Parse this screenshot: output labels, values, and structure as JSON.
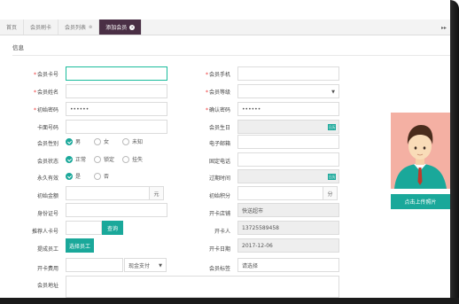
{
  "tabs": [
    {
      "label": "首页",
      "closable": false,
      "active": false
    },
    {
      "label": "会员刷卡",
      "closable": false,
      "active": false
    },
    {
      "label": "会员列表",
      "closable": true,
      "active": false
    },
    {
      "label": "添加会员",
      "closable": true,
      "active": true
    }
  ],
  "tab_scroll": "▸▸",
  "section_title": "信息",
  "form": {
    "card_no": {
      "label": "会员卡号",
      "value": ""
    },
    "phone": {
      "label": "会员手机",
      "value": ""
    },
    "name": {
      "label": "会员姓名",
      "value": ""
    },
    "level": {
      "label": "会员等级",
      "value": ""
    },
    "init_pwd": {
      "label": "初始密码",
      "value": "••••••"
    },
    "confirm_pwd": {
      "label": "确认密码",
      "value": "••••••"
    },
    "card_face": {
      "label": "卡面号码",
      "value": ""
    },
    "birthday": {
      "label": "会员生日",
      "value": ""
    },
    "gender": {
      "label": "会员性别",
      "options": [
        "男",
        "女",
        "未知"
      ],
      "selected": "男"
    },
    "email": {
      "label": "电子邮箱",
      "value": ""
    },
    "status": {
      "label": "会员状态",
      "options": [
        "正常",
        "锁定",
        "挂失"
      ],
      "selected": "正常"
    },
    "landline": {
      "label": "固定电话",
      "value": ""
    },
    "permanent": {
      "label": "永久有效",
      "options": [
        "是",
        "否"
      ],
      "selected": "是"
    },
    "expiry": {
      "label": "过期时间",
      "value": ""
    },
    "init_amount": {
      "label": "初始金额",
      "value": "",
      "unit": "元"
    },
    "init_points": {
      "label": "初始积分",
      "value": "",
      "unit": "分"
    },
    "id_no": {
      "label": "身份证号",
      "value": ""
    },
    "store": {
      "label": "开卡店铺",
      "value": "快送超市"
    },
    "referrer": {
      "label": "推荐人卡号",
      "value": "",
      "button": "查询"
    },
    "opener": {
      "label": "开卡人",
      "value": "13725589458"
    },
    "commission": {
      "label": "提成员工",
      "button": "选择员工"
    },
    "open_date": {
      "label": "开卡日期",
      "value": "2017-12-06"
    },
    "fee": {
      "label": "开卡费用",
      "value": "",
      "pay_method": "现金支付"
    },
    "tags": {
      "label": "会员标签",
      "placeholder": "请选择"
    },
    "address": {
      "label": "会员地址",
      "value": ""
    }
  },
  "calendar_icon_text": "日历",
  "upload_button": "点击上传照片",
  "colors": {
    "accent": "#1aa89a",
    "active_tab": "#4a2f45",
    "required": "#e33333",
    "avatar_bg": "#f4b0a3"
  }
}
